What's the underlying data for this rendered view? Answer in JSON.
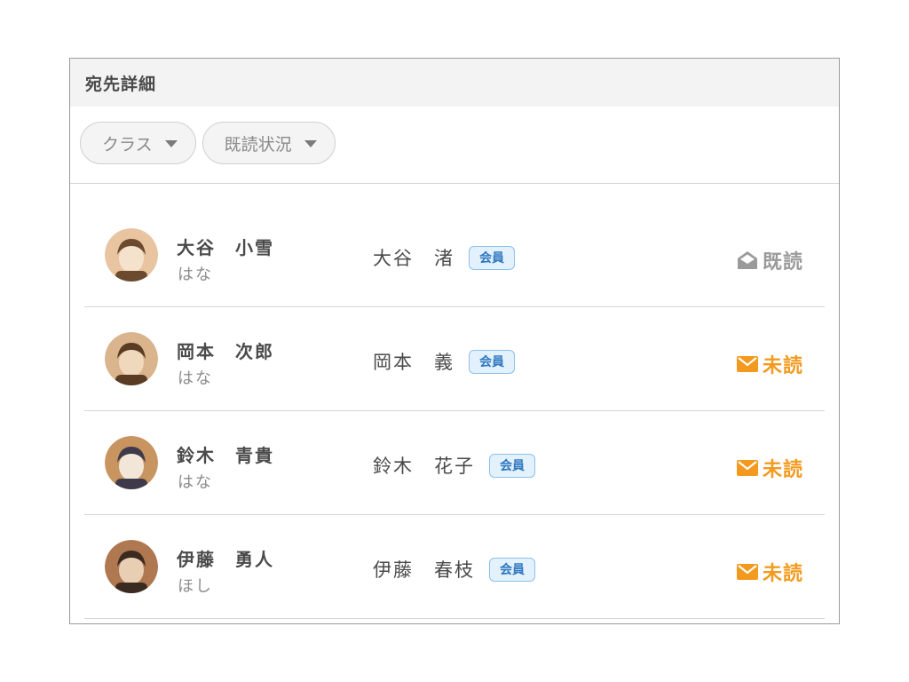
{
  "panel": {
    "title": "宛先詳細"
  },
  "filters": [
    {
      "label": "クラス"
    },
    {
      "label": "既読状況"
    }
  ],
  "rows": [
    {
      "student_name": "大谷　小雪",
      "student_class": "はな",
      "guardian_name": "大谷　渚",
      "badge": "会員",
      "status": "既読",
      "status_type": "read",
      "status_icon": "envelope-open-icon",
      "avatar_palette": [
        "#e8c4a0",
        "#6b4a2e",
        "#f5e2cc"
      ]
    },
    {
      "student_name": "岡本　次郎",
      "student_class": "はな",
      "guardian_name": "岡本　義",
      "badge": "会員",
      "status": "未読",
      "status_type": "unread",
      "status_icon": "envelope-icon",
      "avatar_palette": [
        "#d9b48c",
        "#5a3c24",
        "#f0d8bc"
      ]
    },
    {
      "student_name": "鈴木　青貴",
      "student_class": "はな",
      "guardian_name": "鈴木　花子",
      "badge": "会員",
      "status": "未読",
      "status_type": "unread",
      "status_icon": "envelope-icon",
      "avatar_palette": [
        "#c89460",
        "#3f3a4a",
        "#f2e6d8"
      ]
    },
    {
      "student_name": "伊藤　勇人",
      "student_class": "ほし",
      "guardian_name": "伊藤　春枝",
      "badge": "会員",
      "status": "未読",
      "status_type": "unread",
      "status_icon": "envelope-icon",
      "avatar_palette": [
        "#b07850",
        "#3a2a20",
        "#e8cfb4"
      ]
    }
  ],
  "colors": {
    "read": "#9a9a9a",
    "unread": "#f39a1e",
    "badge_border": "#8cc0ea",
    "badge_bg": "#e3f1fc",
    "badge_text": "#2f78c0"
  }
}
